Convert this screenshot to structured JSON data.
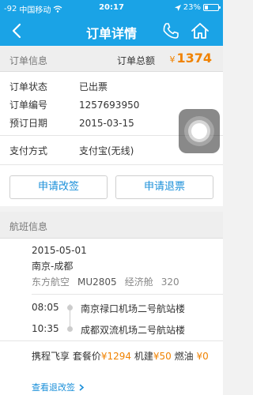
{
  "status_bar": {
    "signal": "-92",
    "carrier": "中国移动",
    "time": "20:17",
    "battery": "23%",
    "battery_level": 0.23
  },
  "nav": {
    "title": "订单详情",
    "back_icon": "chevron-left-icon",
    "phone_icon": "phone-icon",
    "home_icon": "home-icon"
  },
  "order": {
    "section_label": "订单信息",
    "total_label": "订单总额",
    "currency": "¥",
    "total": "1374",
    "rows": [
      {
        "key": "订单状态",
        "value": "已出票"
      },
      {
        "key": "订单编号",
        "value": "1257693950"
      },
      {
        "key": "预订日期",
        "value": "2015-03-15"
      },
      {
        "key": "支付方式",
        "value": "支付宝(无线)"
      }
    ],
    "change_button": "申请改签",
    "refund_button": "申请退票"
  },
  "flight": {
    "section_label": "航班信息",
    "date": "2015-05-01",
    "route": "南京-成都",
    "airline": "东方航空",
    "flight_no": "MU2805",
    "cabin": "经济舱",
    "aircraft": "320",
    "depart_time": "08:05",
    "depart_airport": "南京禄口机场二号航站楼",
    "arrive_time": "10:35",
    "arrive_airport": "成都双流机场二号航站楼",
    "price_prefix": "携程飞享",
    "package_label": "套餐价",
    "package_price": "¥1294",
    "tax_label": "机建",
    "tax_price": "¥50",
    "fuel_label": "燃油",
    "fuel_price": "¥0",
    "policy_link": "查看退改签",
    "policy_icon": "chevron-right-icon"
  },
  "colors": {
    "brand": "#1aa3e6",
    "price": "#f08200",
    "link": "#1a8fd9"
  }
}
